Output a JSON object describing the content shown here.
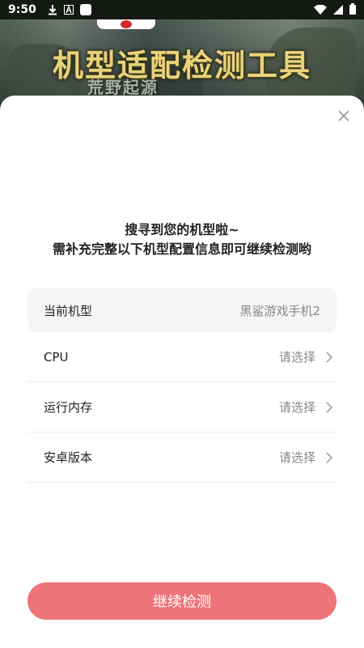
{
  "status_bar": {
    "time": "9:50",
    "icons_left": [
      "download-icon",
      "font-a-icon",
      "app-square-icon"
    ],
    "icons_right": [
      "wifi-icon",
      "signal-icon",
      "battery-icon"
    ]
  },
  "banner": {
    "title": "机型适配检测工具",
    "subtitle": "荒野起源"
  },
  "sheet": {
    "prompt_line1": "搜寻到您的机型啦~",
    "prompt_line2": "需补充完整以下机型配置信息即可继续检测哟",
    "current_model": {
      "label": "当前机型",
      "value": "黑鲨游戏手机2"
    },
    "fields": [
      {
        "label": "CPU",
        "value": "请选择"
      },
      {
        "label": "运行内存",
        "value": "请选择"
      },
      {
        "label": "安卓版本",
        "value": "请选择"
      }
    ],
    "continue_button": "继续检测"
  },
  "colors": {
    "accent": "#ef7479",
    "highlight_bg": "#f4f5f7",
    "banner_title": "#e9d27a"
  }
}
